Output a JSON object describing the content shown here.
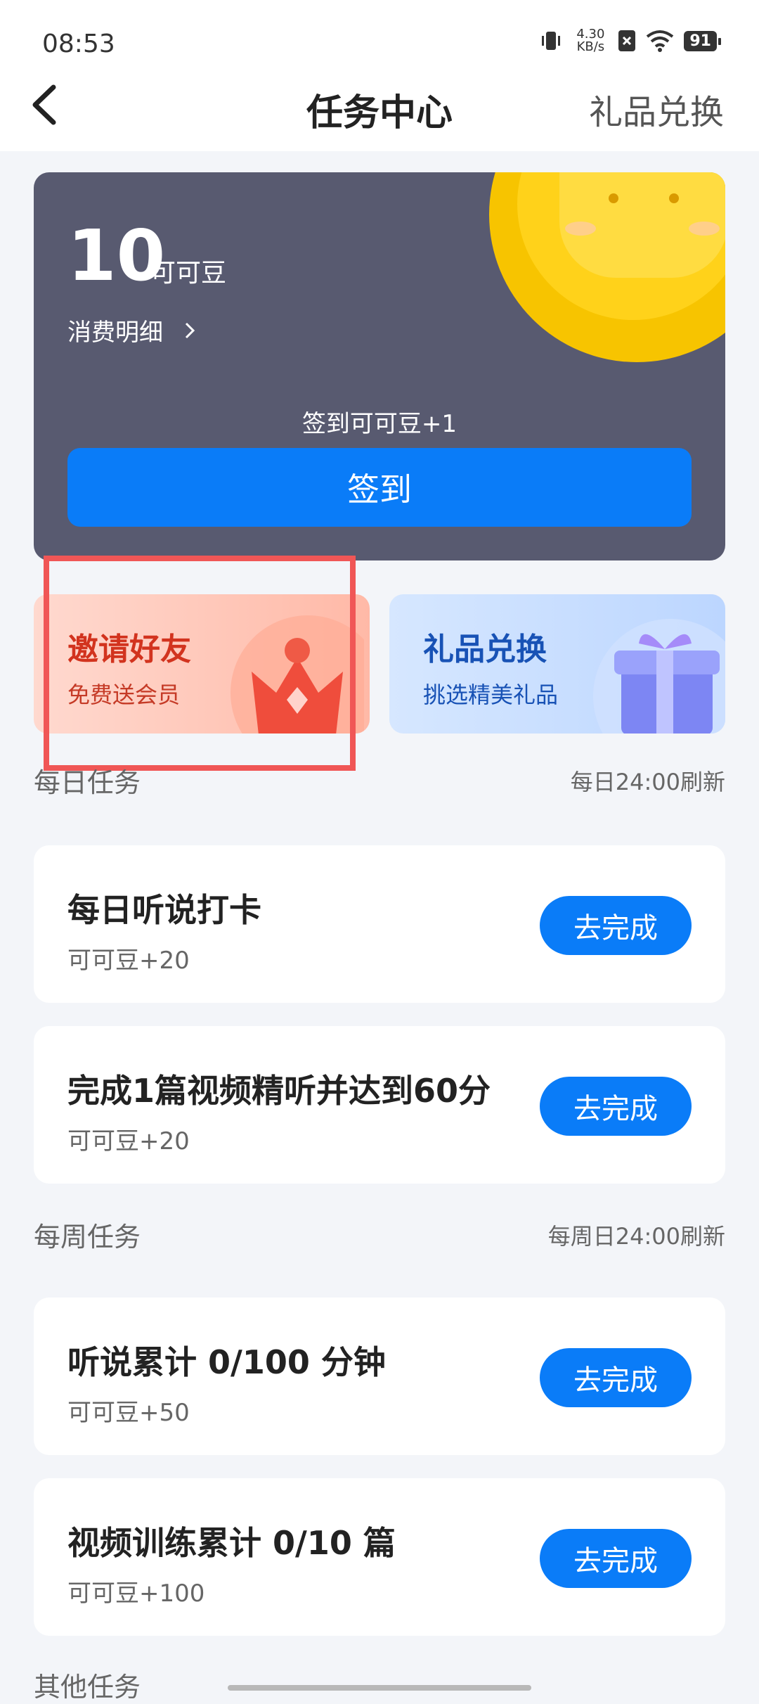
{
  "status": {
    "time": "08:53",
    "net_speed": "4.30",
    "net_unit": "KB/s",
    "battery": "91"
  },
  "nav": {
    "title": "任务中心",
    "right": "礼品兑换"
  },
  "coins": {
    "amount": "10",
    "unit": "可可豆",
    "detail": "消费明细",
    "signin_hint": "签到可可豆+1",
    "signin_button": "签到"
  },
  "promos": {
    "invite": {
      "title": "邀请好友",
      "subtitle": "免费送会员"
    },
    "gift": {
      "title": "礼品兑换",
      "subtitle": "挑选精美礼品"
    }
  },
  "daily": {
    "title": "每日任务",
    "note": "每日24:00刷新",
    "tasks": [
      {
        "name": "每日听说打卡",
        "reward": "可可豆+20",
        "button": "去完成"
      },
      {
        "name": "完成1篇视频精听并达到60分",
        "reward": "可可豆+20",
        "button": "去完成"
      }
    ]
  },
  "weekly": {
    "title": "每周任务",
    "note": "每周日24:00刷新",
    "tasks": [
      {
        "name": "听说累计 0/100 分钟",
        "reward": "可可豆+50",
        "button": "去完成"
      },
      {
        "name": "视频训练累计 0/10 篇",
        "reward": "可可豆+100",
        "button": "去完成"
      }
    ]
  },
  "other": {
    "title": "其他任务"
  }
}
